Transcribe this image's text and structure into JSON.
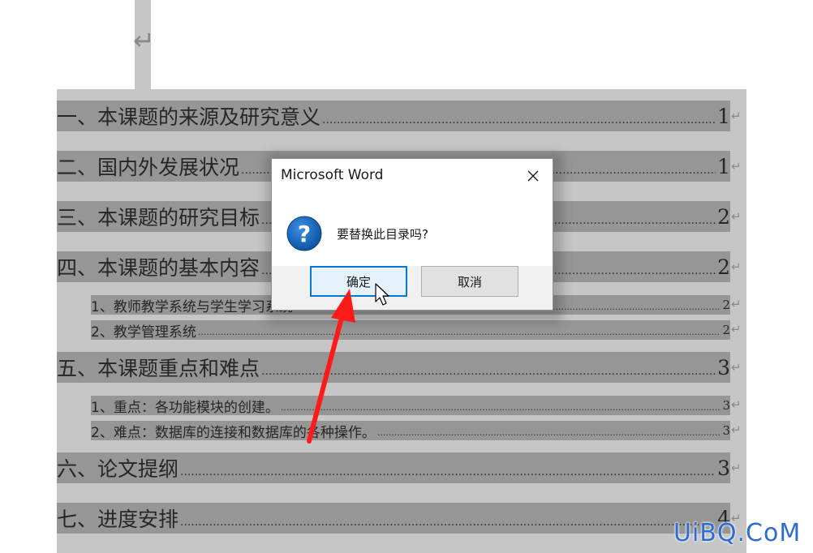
{
  "document": {
    "paragraph_mark": "↵",
    "toc": [
      {
        "level": 1,
        "title": "一、本课题的来源及研究意义",
        "page": "1"
      },
      {
        "level": 1,
        "title": "二、国内外发展状况",
        "page": "1"
      },
      {
        "level": 1,
        "title": "三、本课题的研究目标",
        "page": "2"
      },
      {
        "level": 1,
        "title": "四、本课题的基本内容",
        "page": "2"
      },
      {
        "level": 2,
        "title": "1、教师教学系统与学生学习系统",
        "page": "2"
      },
      {
        "level": 2,
        "title": "2、教学管理系统",
        "page": "2"
      },
      {
        "level": 1,
        "title": "五、本课题重点和难点",
        "page": "3"
      },
      {
        "level": 2,
        "title": "1、重点：各功能模块的创建。",
        "page": "3"
      },
      {
        "level": 2,
        "title": "2、难点：数据库的连接和数据库的各种操作。",
        "page": "3"
      },
      {
        "level": 1,
        "title": "六、论文提纲",
        "page": "3"
      },
      {
        "level": 1,
        "title": "七、进度安排",
        "page": "4"
      }
    ]
  },
  "dialog": {
    "title": "Microsoft Word",
    "message": "要替换此目录吗?",
    "ok_label": "确定",
    "cancel_label": "取消",
    "icon": "question-icon",
    "close_icon": "close-icon"
  },
  "annotation": {
    "arrow_color": "#ff1a1a"
  },
  "watermark": {
    "text": "UiBQ.CoM",
    "color": "#2f6bd6"
  }
}
